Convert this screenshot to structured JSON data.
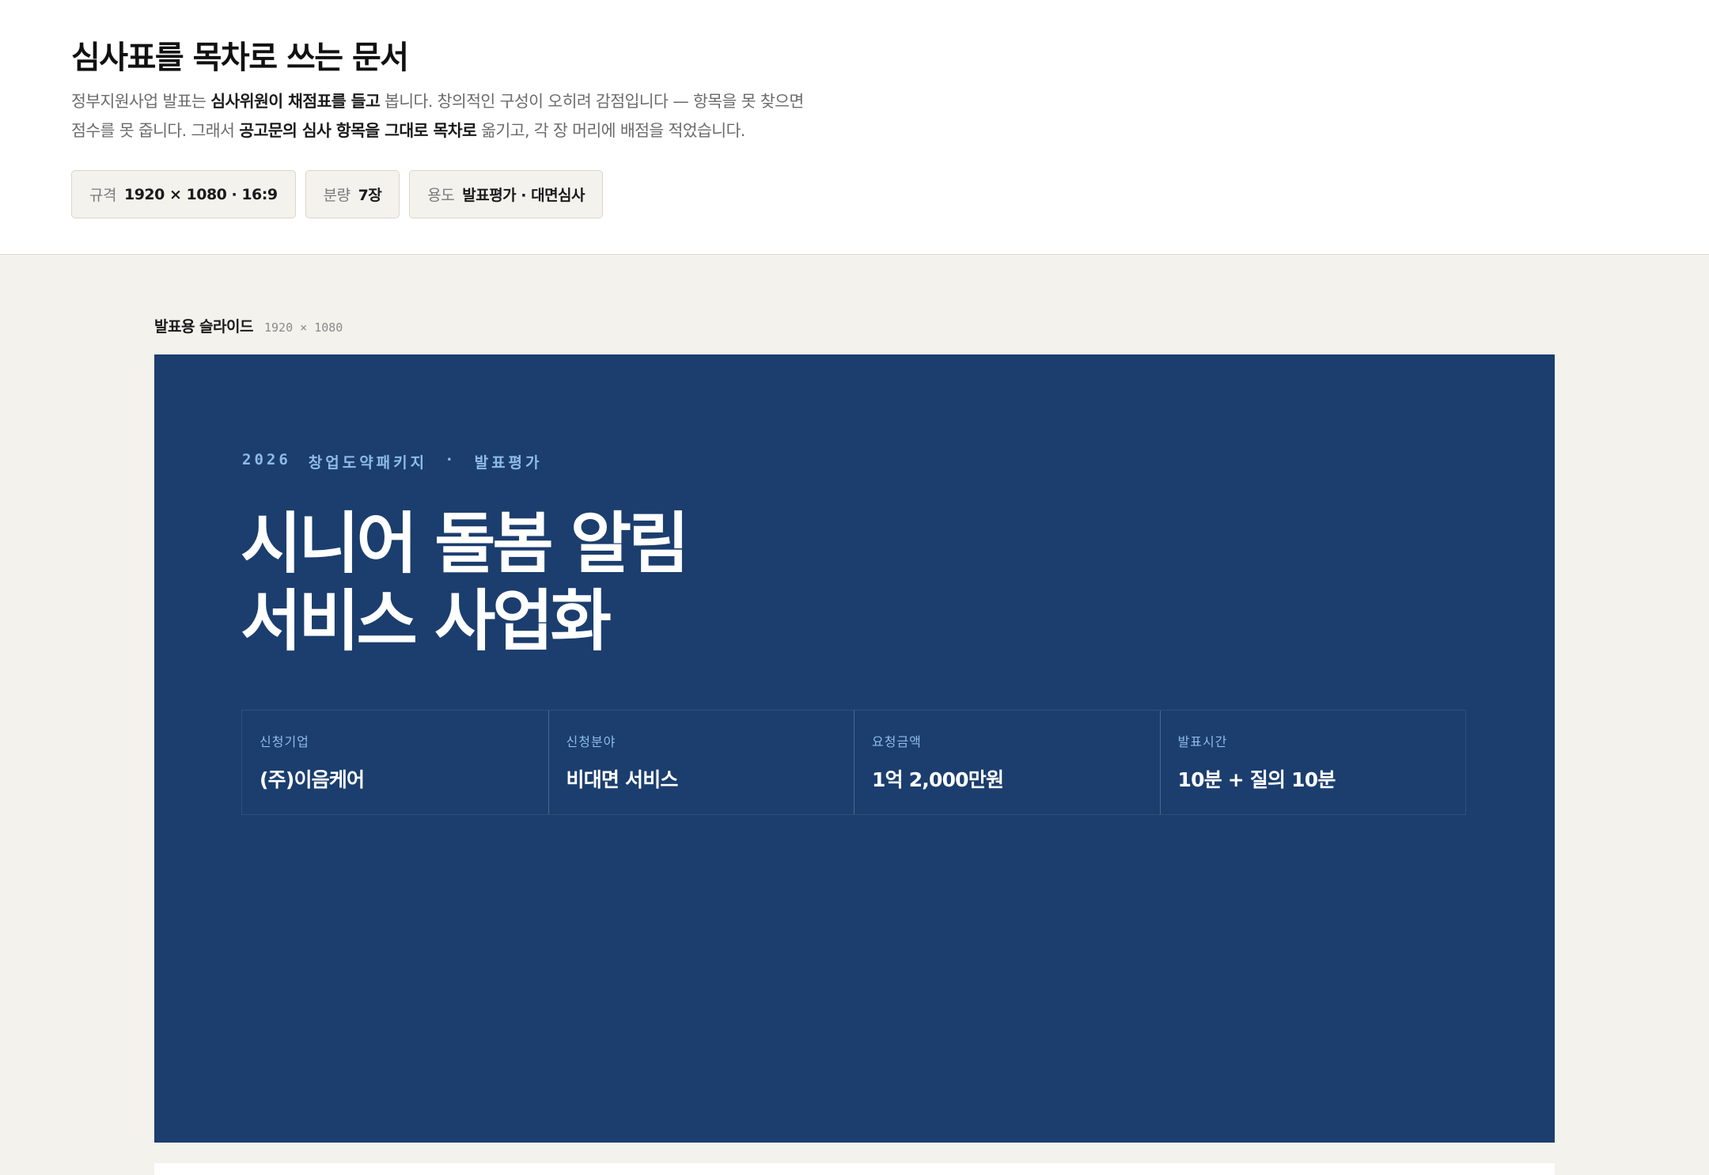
{
  "header": {
    "title": "심사표를 목차로 쓰는 문서",
    "intro": {
      "line1_a": "정부지원사업 발표는 ",
      "line1_b": "심사위원이 채점표를 들고",
      "line1_c": " 봅니다. 창의적인 구성이 오히려 감점입니다 — 항목을 못 찾으면",
      "line2_a": "점수를 못 줍니다. 그래서 ",
      "line2_b": "공고문의 심사 항목을 그대로 목차로",
      "line2_c": " 옮기고, 각 장 머리에 배점을 적었습니다."
    },
    "chips": [
      {
        "key": "규격",
        "value": "1920 × 1080 · 16:9"
      },
      {
        "key": "분량",
        "value": "7장"
      },
      {
        "key": "용도",
        "value": "발표평가 · 대면심사"
      }
    ]
  },
  "section": {
    "name": "발표용 슬라이드",
    "dims": "1920 × 1080"
  },
  "slide": {
    "eyebrow_year": "2026",
    "eyebrow_program": "창업도약패키지",
    "eyebrow_sep": "·",
    "eyebrow_type": "발표평가",
    "title_line1": "시니어 돌봄 알림",
    "title_line2": "서비스 사업화",
    "info": [
      {
        "label": "신청기업",
        "value": "(주)이음케어"
      },
      {
        "label": "신청분야",
        "value": "비대면 서비스"
      },
      {
        "label": "요청금액",
        "value": "1억 2,000만원"
      },
      {
        "label": "발표시간",
        "value": "10분 + 질의 10분"
      }
    ]
  },
  "colors": {
    "slide_bg": "#1b3e6e",
    "accent_light_blue": "#8fbbe8",
    "page_bg": "#f4f2ed"
  }
}
